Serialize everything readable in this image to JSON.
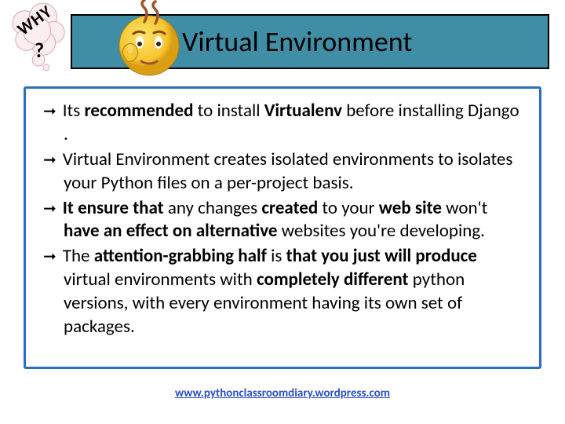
{
  "header": {
    "title": "Virtual Environment"
  },
  "badge": {
    "text": "WHY",
    "mark": "?"
  },
  "bullets": [
    {
      "parts": [
        {
          "t": "Its ",
          "b": false
        },
        {
          "t": "recommended",
          "b": true
        },
        {
          "t": " to install ",
          "b": false
        },
        {
          "t": "Virtualenv",
          "b": true
        },
        {
          "t": " before installing Django .",
          "b": false
        }
      ]
    },
    {
      "parts": [
        {
          "t": "Virtual Environment creates isolated environments to isolates your Python files on a per-project basis.",
          "b": false
        }
      ]
    },
    {
      "parts": [
        {
          "t": "It  ensure  that",
          "b": true
        },
        {
          "t": " any  changes ",
          "b": false
        },
        {
          "t": "created",
          "b": true
        },
        {
          "t": " to  your ",
          "b": false
        },
        {
          "t": "web site",
          "b": true
        },
        {
          "t": " won't ",
          "b": false
        },
        {
          "t": "have  an  effect  on alternative",
          "b": true
        },
        {
          "t": " websites you're developing.",
          "b": false
        }
      ]
    },
    {
      "parts": [
        {
          "t": "The ",
          "b": false
        },
        {
          "t": "attention-grabbing half",
          "b": true
        },
        {
          "t": " is ",
          "b": false
        },
        {
          "t": "that                           you just will produce",
          "b": true
        },
        {
          "t": " virtual environments with ",
          "b": false
        },
        {
          "t": "completely different",
          "b": true
        },
        {
          "t": " python versions, with every environment having its own set of packages.",
          "b": false
        }
      ]
    }
  ],
  "footer": {
    "url_text": "www.pythonclassroomdiary.wordpress.com"
  }
}
